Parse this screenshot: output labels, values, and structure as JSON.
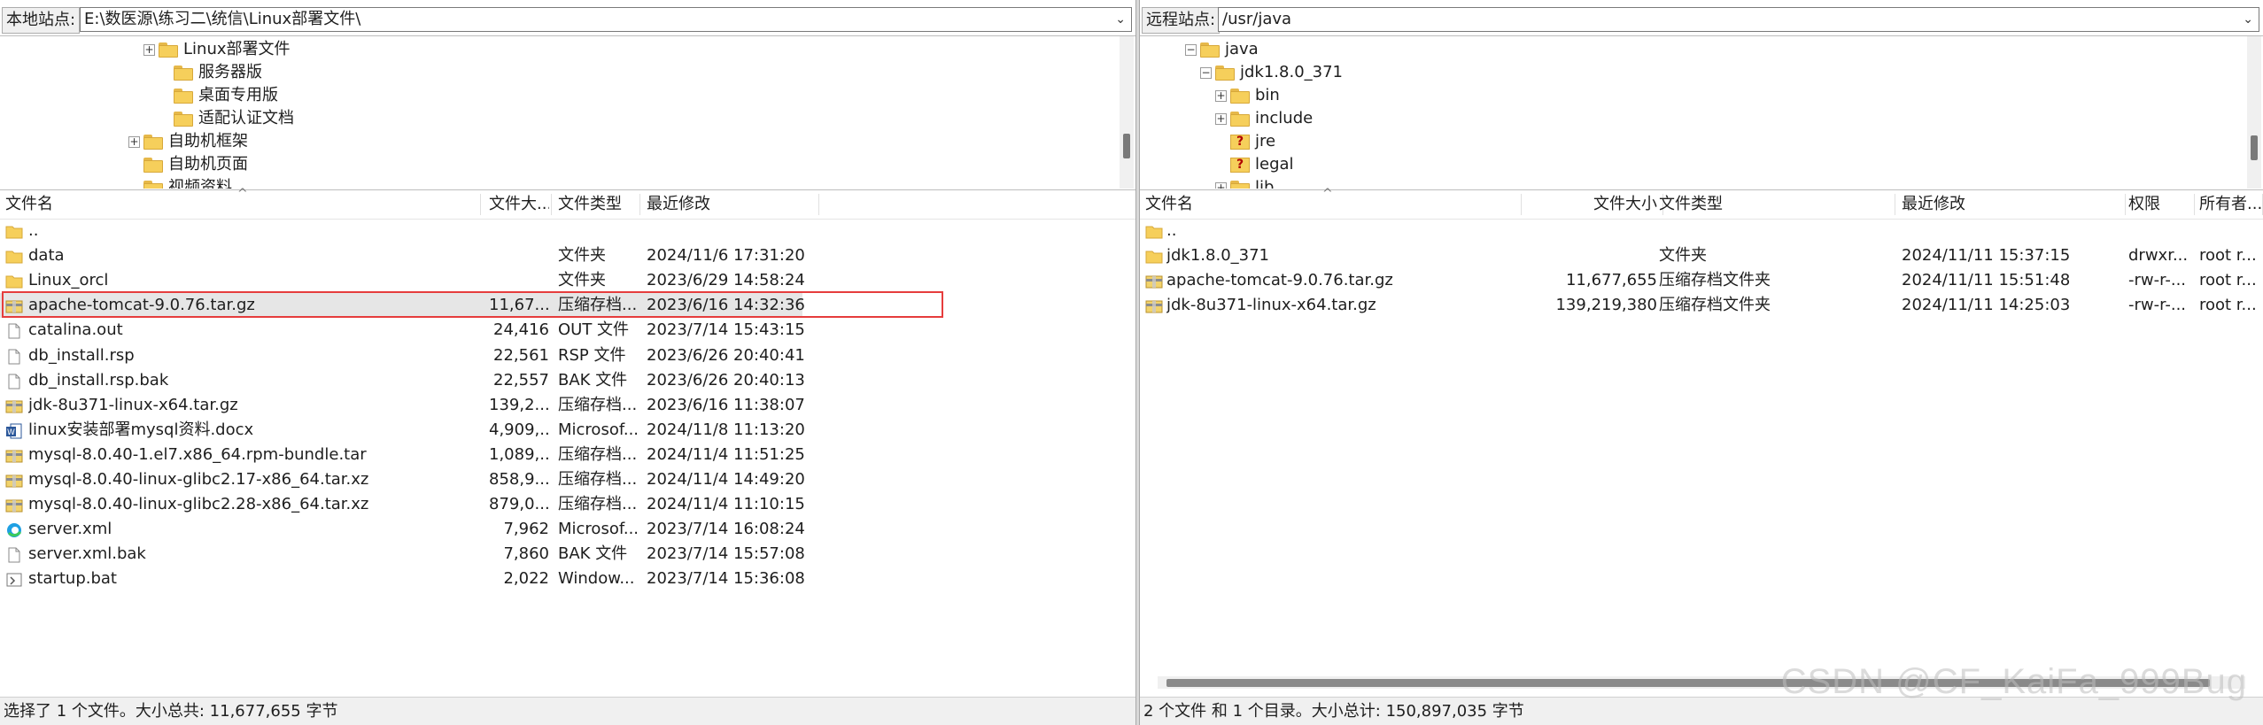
{
  "local": {
    "site_label": "本地站点:",
    "site_path": "E:\\数医源\\练习二\\统信\\Linux部署文件\\",
    "tree": [
      {
        "label": "Linux部署文件",
        "indent": 2,
        "expand": "+"
      },
      {
        "label": "服务器版",
        "indent": 3,
        "expand": ""
      },
      {
        "label": "桌面专用版",
        "indent": 3,
        "expand": ""
      },
      {
        "label": "适配认证文档",
        "indent": 3,
        "expand": ""
      },
      {
        "label": "自助机框架",
        "indent": 1,
        "expand": "+"
      },
      {
        "label": "自助机页面",
        "indent": 1,
        "expand": ""
      },
      {
        "label": "视频资料",
        "indent": 1,
        "expand": ""
      }
    ],
    "columns": {
      "name": "文件名",
      "size": "文件大...",
      "type": "文件类型",
      "modified": "最近修改"
    },
    "files": [
      {
        "name": "..",
        "size": "",
        "type": "",
        "modified": "",
        "icon": "folder-icon"
      },
      {
        "name": "data",
        "size": "",
        "type": "文件夹",
        "modified": "2024/11/6 17:31:20",
        "icon": "folder-icon"
      },
      {
        "name": "Linux_orcl",
        "size": "",
        "type": "文件夹",
        "modified": "2023/6/29 14:58:24",
        "icon": "folder-icon"
      },
      {
        "name": "apache-tomcat-9.0.76.tar.gz",
        "size": "11,67...",
        "type": "压缩存档...",
        "modified": "2023/6/16 14:32:36",
        "icon": "archive-icon",
        "selected": true
      },
      {
        "name": "catalina.out",
        "size": "24,416",
        "type": "OUT 文件",
        "modified": "2023/7/14 15:43:15",
        "icon": "file-icon"
      },
      {
        "name": "db_install.rsp",
        "size": "22,561",
        "type": "RSP 文件",
        "modified": "2023/6/26 20:40:41",
        "icon": "file-icon"
      },
      {
        "name": "db_install.rsp.bak",
        "size": "22,557",
        "type": "BAK 文件",
        "modified": "2023/6/26 20:40:13",
        "icon": "file-icon"
      },
      {
        "name": "jdk-8u371-linux-x64.tar.gz",
        "size": "139,2...",
        "type": "压缩存档...",
        "modified": "2023/6/16 11:38:07",
        "icon": "archive-icon"
      },
      {
        "name": "linux安装部署mysql资料.docx",
        "size": "4,909,...",
        "type": "Microsof...",
        "modified": "2024/11/8 11:13:20",
        "icon": "word-icon"
      },
      {
        "name": "mysql-8.0.40-1.el7.x86_64.rpm-bundle.tar",
        "size": "1,089,...",
        "type": "压缩存档...",
        "modified": "2024/11/4 11:51:25",
        "icon": "archive-icon"
      },
      {
        "name": "mysql-8.0.40-linux-glibc2.17-x86_64.tar.xz",
        "size": "858,9...",
        "type": "压缩存档...",
        "modified": "2024/11/4 14:49:20",
        "icon": "archive-icon"
      },
      {
        "name": "mysql-8.0.40-linux-glibc2.28-x86_64.tar.xz",
        "size": "879,0...",
        "type": "压缩存档...",
        "modified": "2024/11/4 11:10:15",
        "icon": "archive-icon"
      },
      {
        "name": "server.xml",
        "size": "7,962",
        "type": "Microsof...",
        "modified": "2023/7/14 16:08:24",
        "icon": "edge-icon"
      },
      {
        "name": "server.xml.bak",
        "size": "7,860",
        "type": "BAK 文件",
        "modified": "2023/7/14 15:57:08",
        "icon": "file-icon"
      },
      {
        "name": "startup.bat",
        "size": "2,022",
        "type": "Window...",
        "modified": "2023/7/14 15:36:08",
        "icon": "bat-icon"
      }
    ],
    "status": "选择了 1 个文件。大小总共: 11,677,655 字节"
  },
  "remote": {
    "site_label": "远程站点:",
    "site_path": "/usr/java",
    "tree": [
      {
        "label": "java",
        "indent": 1,
        "expand": "-",
        "icon": "folder"
      },
      {
        "label": "jdk1.8.0_371",
        "indent": 2,
        "expand": "-",
        "icon": "folder"
      },
      {
        "label": "bin",
        "indent": 3,
        "expand": "+",
        "icon": "folder"
      },
      {
        "label": "include",
        "indent": 3,
        "expand": "+",
        "icon": "folder"
      },
      {
        "label": "jre",
        "indent": 3,
        "expand": "",
        "icon": "question"
      },
      {
        "label": "legal",
        "indent": 3,
        "expand": "",
        "icon": "question"
      },
      {
        "label": "lib",
        "indent": 3,
        "expand": "+",
        "icon": "folder"
      }
    ],
    "columns": {
      "name": "文件名",
      "size": "文件大小",
      "type": "文件类型",
      "modified": "最近修改",
      "perms": "权限",
      "owner": "所有者..."
    },
    "files": [
      {
        "name": "..",
        "size": "",
        "type": "",
        "modified": "",
        "perms": "",
        "owner": "",
        "icon": "folder-icon"
      },
      {
        "name": "jdk1.8.0_371",
        "size": "",
        "type": "文件夹",
        "modified": "2024/11/11 15:37:15",
        "perms": "drwxr...",
        "owner": "root r...",
        "icon": "folder-icon"
      },
      {
        "name": "apache-tomcat-9.0.76.tar.gz",
        "size": "11,677,655",
        "type": "压缩存档文件夹",
        "modified": "2024/11/11 15:51:48",
        "perms": "-rw-r-...",
        "owner": "root r...",
        "icon": "archive-icon"
      },
      {
        "name": "jdk-8u371-linux-x64.tar.gz",
        "size": "139,219,380",
        "type": "压缩存档文件夹",
        "modified": "2024/11/11 14:25:03",
        "perms": "-rw-r-...",
        "owner": "root r...",
        "icon": "archive-icon"
      }
    ],
    "status": "2 个文件 和 1 个目录。大小总计: 150,897,035 字节"
  },
  "watermark": "CSDN @CF_KaiFa_999Bug"
}
